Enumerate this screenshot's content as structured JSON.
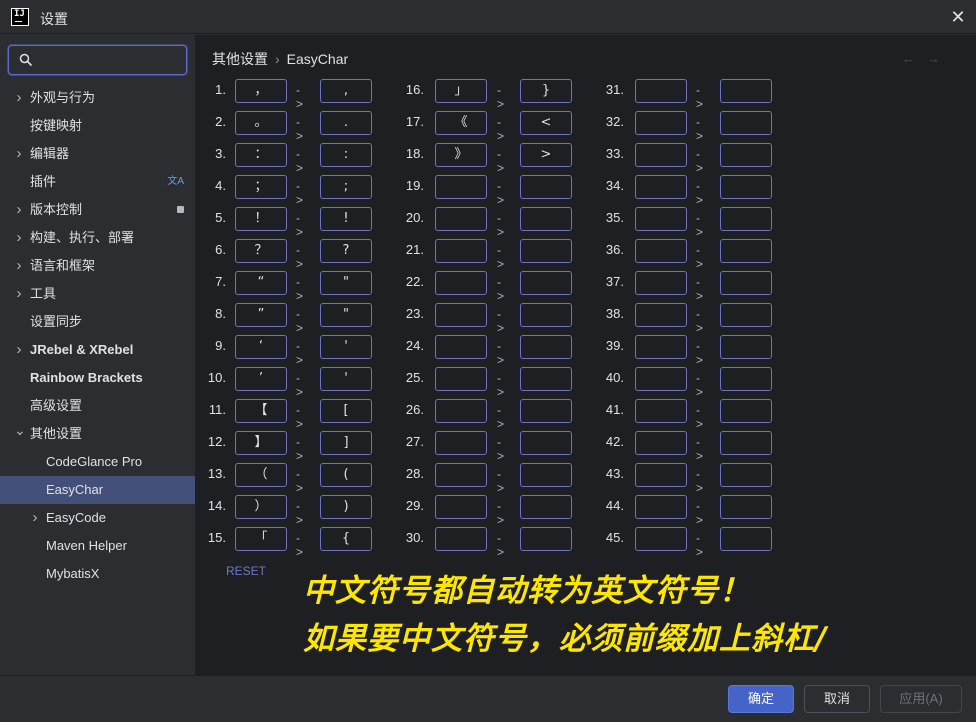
{
  "window": {
    "title": "设置",
    "app_icon_text": "IJ"
  },
  "sidebar": {
    "search_placeholder": "",
    "items": [
      {
        "label": "外观与行为",
        "expandable": true,
        "indent": 0
      },
      {
        "label": "按键映射",
        "expandable": false,
        "indent": 0
      },
      {
        "label": "编辑器",
        "expandable": true,
        "indent": 0
      },
      {
        "label": "插件",
        "expandable": false,
        "indent": 0,
        "trailing_icon": "translate-icon"
      },
      {
        "label": "版本控制",
        "expandable": true,
        "indent": 0,
        "trailing_icon": "modified-badge-icon"
      },
      {
        "label": "构建、执行、部署",
        "expandable": true,
        "indent": 0
      },
      {
        "label": "语言和框架",
        "expandable": true,
        "indent": 0
      },
      {
        "label": "工具",
        "expandable": true,
        "indent": 0
      },
      {
        "label": "设置同步",
        "expandable": false,
        "indent": 0
      },
      {
        "label": "JRebel & XRebel",
        "expandable": true,
        "indent": 0,
        "bold": true
      },
      {
        "label": "Rainbow Brackets",
        "expandable": false,
        "indent": 0,
        "bold": true
      },
      {
        "label": "高级设置",
        "expandable": false,
        "indent": 0
      },
      {
        "label": "其他设置",
        "expandable": true,
        "expanded": true,
        "indent": 0
      },
      {
        "label": "CodeGlance Pro",
        "expandable": false,
        "indent": 1
      },
      {
        "label": "EasyChar",
        "expandable": false,
        "indent": 1,
        "selected": true
      },
      {
        "label": "EasyCode",
        "expandable": true,
        "indent": 1
      },
      {
        "label": "Maven Helper",
        "expandable": false,
        "indent": 1
      },
      {
        "label": "MybatisX",
        "expandable": false,
        "indent": 1
      }
    ]
  },
  "breadcrumb": {
    "parent": "其他设置",
    "separator": "›",
    "current": "EasyChar"
  },
  "mappings": {
    "arrow": "->",
    "items": [
      {
        "n": "1.",
        "from": "，",
        "to": ","
      },
      {
        "n": "2.",
        "from": "。",
        "to": "."
      },
      {
        "n": "3.",
        "from": "：",
        "to": ":"
      },
      {
        "n": "4.",
        "from": "；",
        "to": ";"
      },
      {
        "n": "5.",
        "from": "！",
        "to": "!"
      },
      {
        "n": "6.",
        "from": "？",
        "to": "?"
      },
      {
        "n": "7.",
        "from": "“",
        "to": "\""
      },
      {
        "n": "8.",
        "from": "”",
        "to": "\""
      },
      {
        "n": "9.",
        "from": "‘",
        "to": "'"
      },
      {
        "n": "10.",
        "from": "’",
        "to": "'"
      },
      {
        "n": "11.",
        "from": "【",
        "to": "["
      },
      {
        "n": "12.",
        "from": "】",
        "to": "]"
      },
      {
        "n": "13.",
        "from": "（",
        "to": "("
      },
      {
        "n": "14.",
        "from": "）",
        "to": ")"
      },
      {
        "n": "15.",
        "from": "「",
        "to": "{"
      },
      {
        "n": "16.",
        "from": "」",
        "to": "}"
      },
      {
        "n": "17.",
        "from": "《",
        "to": "<"
      },
      {
        "n": "18.",
        "from": "》",
        "to": ">"
      },
      {
        "n": "19.",
        "from": "",
        "to": ""
      },
      {
        "n": "20.",
        "from": "",
        "to": ""
      },
      {
        "n": "21.",
        "from": "",
        "to": ""
      },
      {
        "n": "22.",
        "from": "",
        "to": ""
      },
      {
        "n": "23.",
        "from": "",
        "to": ""
      },
      {
        "n": "24.",
        "from": "",
        "to": ""
      },
      {
        "n": "25.",
        "from": "",
        "to": ""
      },
      {
        "n": "26.",
        "from": "",
        "to": ""
      },
      {
        "n": "27.",
        "from": "",
        "to": ""
      },
      {
        "n": "28.",
        "from": "",
        "to": ""
      },
      {
        "n": "29.",
        "from": "",
        "to": ""
      },
      {
        "n": "30.",
        "from": "",
        "to": ""
      },
      {
        "n": "31.",
        "from": "",
        "to": ""
      },
      {
        "n": "32.",
        "from": "",
        "to": ""
      },
      {
        "n": "33.",
        "from": "",
        "to": ""
      },
      {
        "n": "34.",
        "from": "",
        "to": ""
      },
      {
        "n": "35.",
        "from": "",
        "to": ""
      },
      {
        "n": "36.",
        "from": "",
        "to": ""
      },
      {
        "n": "37.",
        "from": "",
        "to": ""
      },
      {
        "n": "38.",
        "from": "",
        "to": ""
      },
      {
        "n": "39.",
        "from": "",
        "to": ""
      },
      {
        "n": "40.",
        "from": "",
        "to": ""
      },
      {
        "n": "41.",
        "from": "",
        "to": ""
      },
      {
        "n": "42.",
        "from": "",
        "to": ""
      },
      {
        "n": "43.",
        "from": "",
        "to": ""
      },
      {
        "n": "44.",
        "from": "",
        "to": ""
      },
      {
        "n": "45.",
        "from": "",
        "to": ""
      }
    ]
  },
  "reset_label": "RESET",
  "annotation": {
    "line1": "中文符号都自动转为英文符号！",
    "line2": "如果要中文符号，必须前缀加上斜杠/",
    "color": "#ffe600"
  },
  "footer": {
    "ok_label": "确定",
    "cancel_label": "取消",
    "apply_label": "应用(A)",
    "help_label": "?"
  },
  "colors": {
    "accent": "#4664c8",
    "selected_row": "#43517a",
    "field_border": "#6b74c4"
  }
}
